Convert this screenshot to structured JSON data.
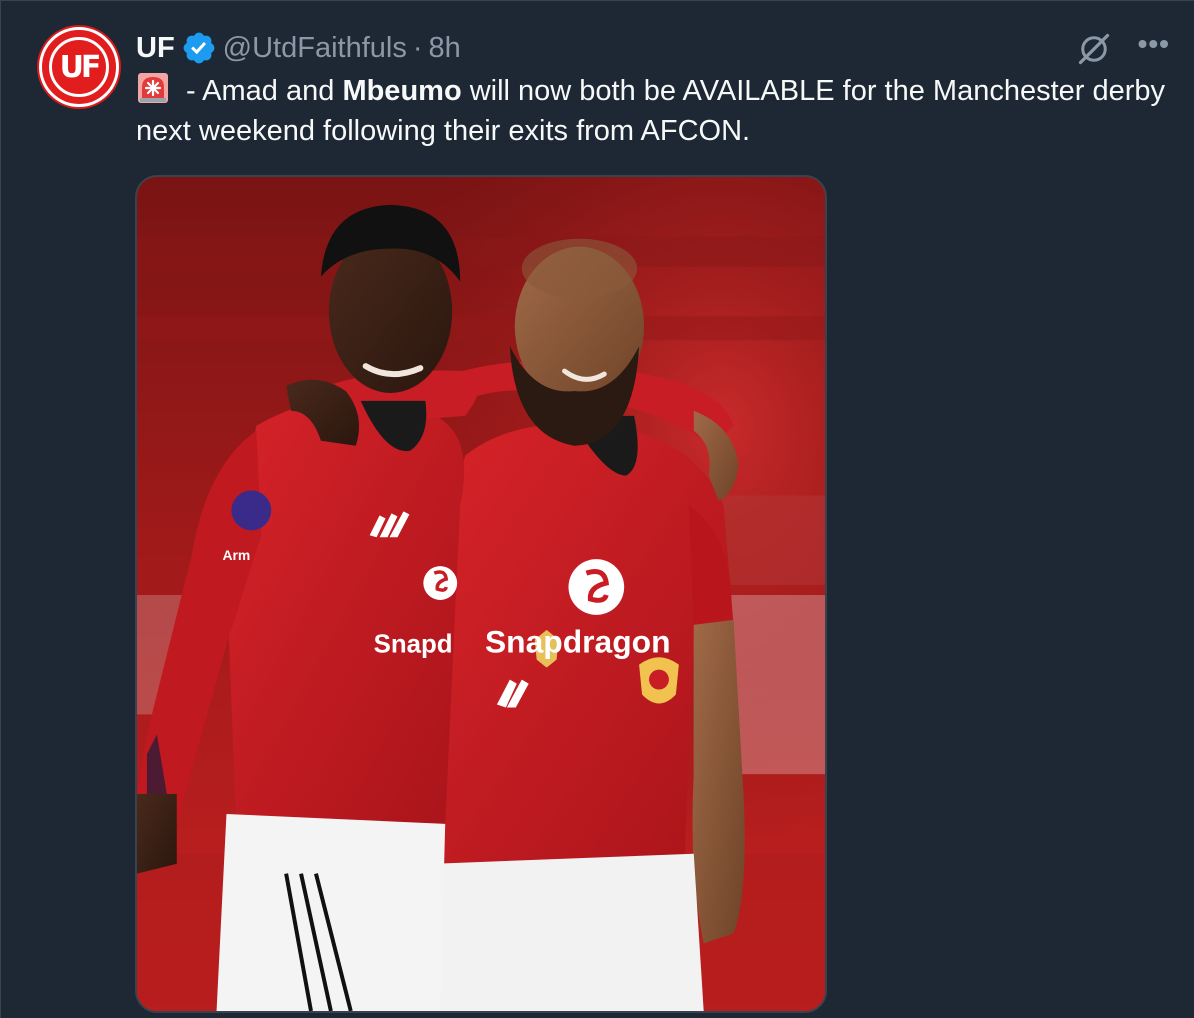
{
  "tweet": {
    "avatar": {
      "icon": "uf-logo",
      "text": "UF",
      "color": "#e11d1d"
    },
    "name": "UF",
    "verified": true,
    "handle": "@UtdFaithfuls",
    "separator": "·",
    "time": "8h",
    "text": {
      "emoji": "rotating-light",
      "part1": " - Amad and ",
      "bold": "Mbeumo",
      "part2": " will now both be AVAILABLE for the Manchester derby next weekend following their exits from AFCON."
    },
    "media": {
      "sponsor_left": "Snapd",
      "sponsor_right": "Snapdragon",
      "sleeve_badge": "Arm",
      "shirt_color": "#c81d25"
    }
  },
  "icons": {
    "verified": "verified-badge-icon",
    "grok": "grok-icon",
    "more": "more-icon"
  },
  "colors": {
    "background": "#1e2734",
    "text": "#f7f9f9",
    "muted": "#8b98a5",
    "verified": "#1d9bf0"
  }
}
